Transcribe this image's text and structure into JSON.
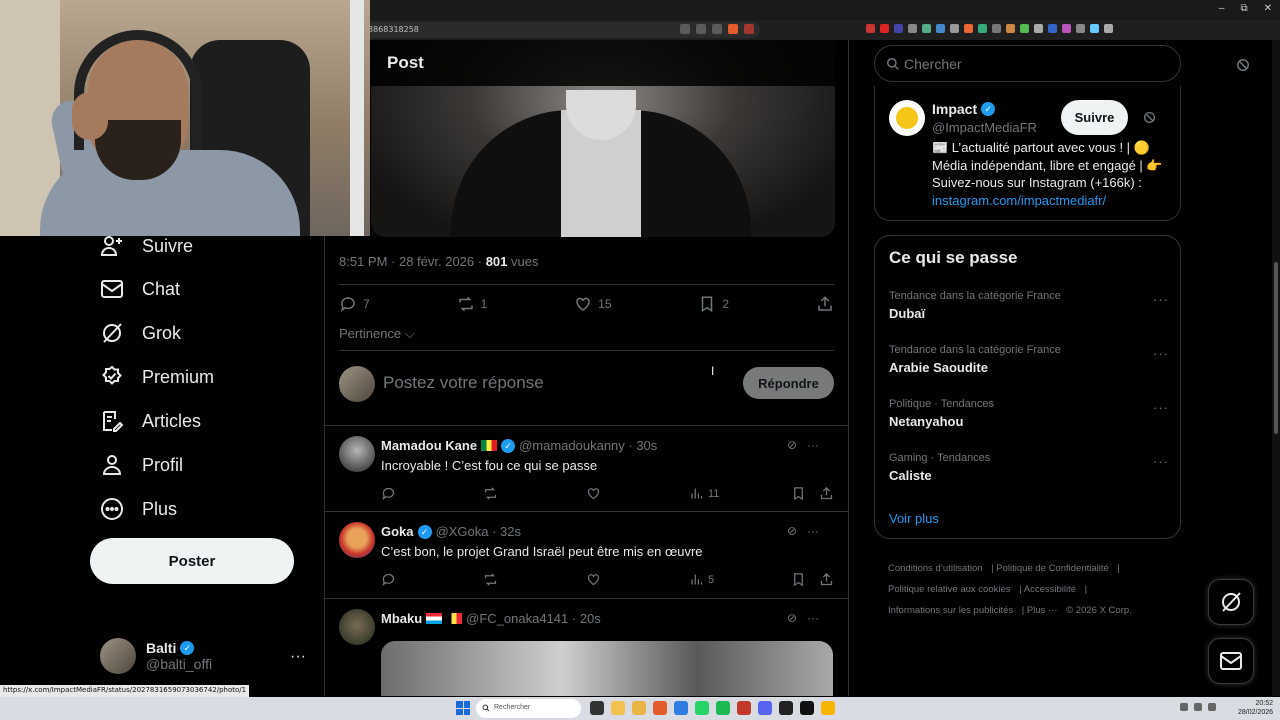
{
  "browser": {
    "url_fragment": "8868318258",
    "status_url": "https://x.com/ImpactMediaFR/status/2027831659073036742/photo/1"
  },
  "header": {
    "title": "Post"
  },
  "nav": {
    "items": [
      {
        "label": "Suivre",
        "top": 0
      },
      {
        "label": "Chat"
      },
      {
        "label": "Grok"
      },
      {
        "label": "Premium"
      },
      {
        "label": "Articles"
      },
      {
        "label": "Profil"
      },
      {
        "label": "Plus"
      }
    ],
    "post_button": "Poster",
    "account": {
      "name": "Balti",
      "handle": "@balti_offi",
      "more": "···"
    }
  },
  "post": {
    "time": "8:51 PM · 28 févr. 2026 · ",
    "views_count": "801",
    "views_label": " vues",
    "replies": "7",
    "reposts": "1",
    "likes": "15",
    "bookmarks": "2",
    "sort_label": "Pertinence",
    "reply_placeholder": "Postez votre réponse",
    "reply_button": "Répondre"
  },
  "replies": [
    {
      "name": "Mamadou Kane",
      "handle": "@mamadoukanny · 30s",
      "text": "Incroyable ! C’est fou ce qui se passe",
      "views": "11"
    },
    {
      "name": "Goka",
      "handle": "@XGoka · 32s",
      "text": "C’est bon, le projet Grand Israël peut être mis en œuvre",
      "views": "5"
    },
    {
      "name": "Mbaku",
      "handle": "@FC_onaka4141 · 20s"
    }
  ],
  "right": {
    "search_placeholder": "Chercher",
    "profile": {
      "name": "Impact",
      "handle": "@ImpactMediaFR",
      "follow": "Suivre",
      "bio": "📰 L’actualité partout avec vous ! | 🟡 Média indépendant, libre et engagé | 👉 Suivez-nous sur Instagram (+166k) : ",
      "link": "instagram.com/impactmediafr/"
    },
    "trends_title": "Ce qui se passe",
    "trends": [
      {
        "context": "Tendance dans la catégorie France",
        "title": "Dubaï"
      },
      {
        "context": "Tendance dans la catégorie France",
        "title": "Arabie Saoudite"
      },
      {
        "context": "Politique · Tendances",
        "title": "Netanyahou"
      },
      {
        "context": "Gaming · Tendances",
        "title": "Caliste"
      }
    ],
    "show_more": "Voir plus",
    "footer": {
      "terms": "Conditions d’utilisation",
      "privacy": "Politique de Confidentialité",
      "cookies": "Politique relative aux cookies",
      "accessibility": "Accessibilité",
      "ads": "Informations sur les publicités",
      "more": "Plus ···",
      "copyright": "© 2026 X Corp."
    }
  },
  "taskbar": {
    "search": "Rechercher",
    "time": "20:52",
    "date": "28/02/2026"
  },
  "colors": {
    "accent": "#1d9bf0",
    "muted": "#71767b",
    "border": "#2f3336",
    "text": "#e7e9ea"
  }
}
